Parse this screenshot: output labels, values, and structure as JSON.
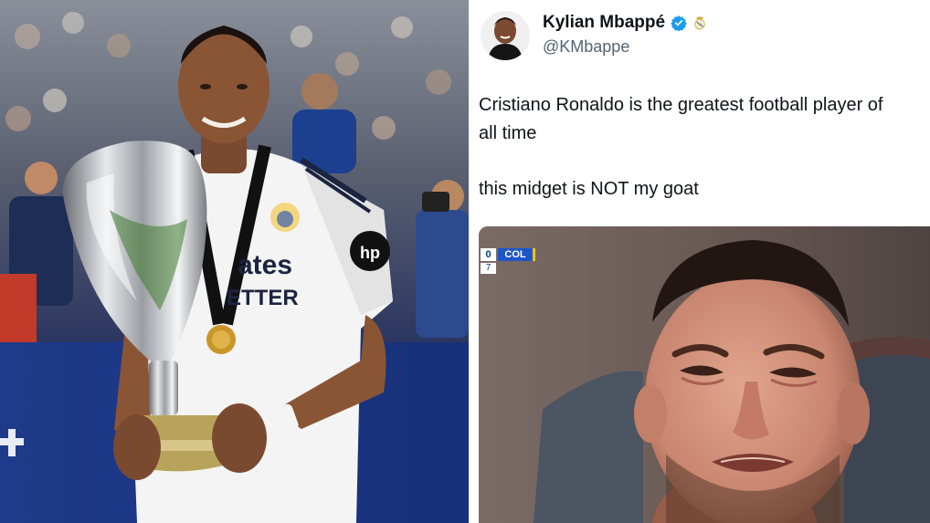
{
  "tweet": {
    "display_name": "Kylian Mbappé",
    "handle": "@KMbappe",
    "verified_icon": "verified-badge-icon",
    "affiliate_icon": "real-madrid-crest-icon",
    "text_line_1": "Cristiano Ronaldo is the greatest football player of",
    "text_line_2": "all time",
    "text_line_3": "this midget is NOT my goat",
    "media": {
      "scorebug_score": "0",
      "scorebug_team": "COL",
      "scorebug_minute": "7"
    }
  },
  "photo_left": {
    "shirt_text_1": "ates",
    "shirt_text_2": "ETTER",
    "sponsor_badge": "hp"
  },
  "colors": {
    "verified_blue": "#1d9bf0",
    "handle_grey": "#536471",
    "text_dark": "#0f1419",
    "scorebug_blue": "#1e56c8",
    "scorebug_yellow": "#f2c500"
  }
}
